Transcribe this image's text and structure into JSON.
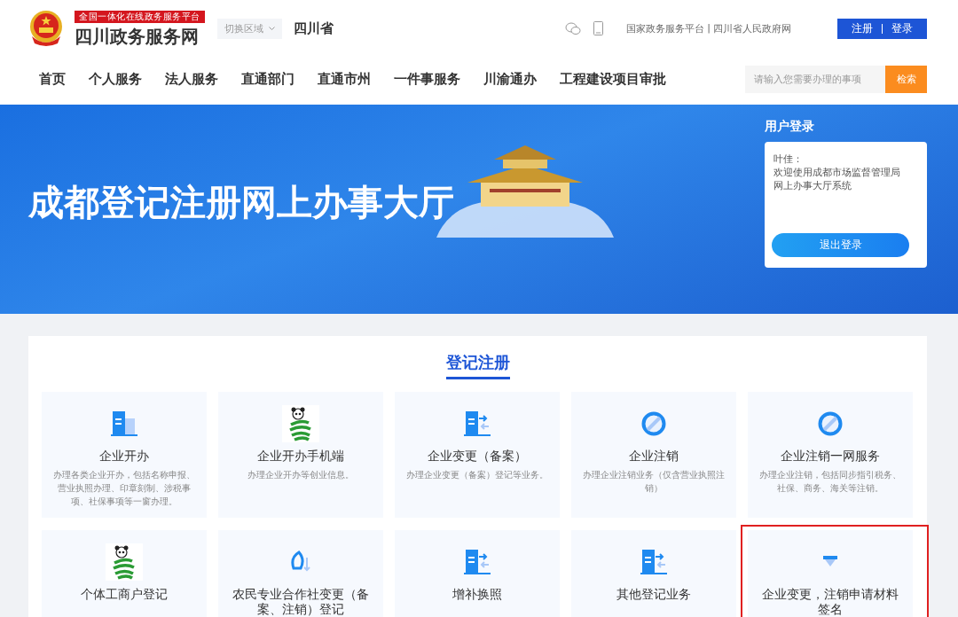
{
  "header": {
    "tagline": "全国一体化在线政务服务平台",
    "site_name": "四川政务服务网",
    "region_switch": "切换区域",
    "region_switch_expanded": false,
    "link_separator": "|",
    "region": "四川省",
    "links": [
      "国家政务服务平台",
      "四川省人民政府网"
    ],
    "auth_buttons": [
      "注册",
      "登录"
    ]
  },
  "nav": {
    "items": [
      {
        "label": "首页"
      },
      {
        "label": "个人服务"
      },
      {
        "label": "法人服务"
      },
      {
        "label": "直通部门"
      },
      {
        "label": "直通市州"
      },
      {
        "label": "一件事服务"
      },
      {
        "label": "川渝通办"
      },
      {
        "label": "工程建设项目审批"
      }
    ],
    "search": {
      "placeholder": "请输入您需要办理的事项",
      "button": "检索"
    }
  },
  "banner": {
    "title": "成都登记注册网上办事大厅"
  },
  "login": {
    "title": "用户登录",
    "user": "叶佳：",
    "welcome": "欢迎使用成都市场监督管理局网上办事大厅系统",
    "logout": "退出登录"
  },
  "section": {
    "title": "登记注册",
    "cards": [
      {
        "kind": "building",
        "title": "企业开办",
        "desc": "办理各类企业开办，包括名称申报、营业执照办理、印章刻制、涉税事项、社保事项等一窗办理。",
        "highlighted": false
      },
      {
        "kind": "panda",
        "title": "企业开办手机端",
        "desc": "办理企业开办等创业信息。",
        "highlighted": false
      },
      {
        "kind": "transfer",
        "title": "企业变更（备案）",
        "desc": "办理企业变更（备案）登记等业务。",
        "highlighted": false
      },
      {
        "kind": "cancel",
        "title": "企业注销",
        "desc": "办理企业注销业务（仅含营业执照注销）",
        "highlighted": false
      },
      {
        "kind": "cancel",
        "title": "企业注销一网服务",
        "desc": "办理企业注销，包括同步指引税务、社保、商务、海关等注销。",
        "highlighted": false
      },
      {
        "kind": "panda",
        "title": "个体工商户登记",
        "highlighted": false
      },
      {
        "kind": "leaf",
        "title": "农民专业合作社变更（备案、注销）登记",
        "highlighted": false
      },
      {
        "kind": "transfer",
        "title": "增补换照",
        "highlighted": false
      },
      {
        "kind": "transfer",
        "title": "其他登记业务",
        "highlighted": false
      },
      {
        "kind": "hourglass",
        "title": "企业变更，注销申请材料签名",
        "highlighted": true
      }
    ]
  }
}
